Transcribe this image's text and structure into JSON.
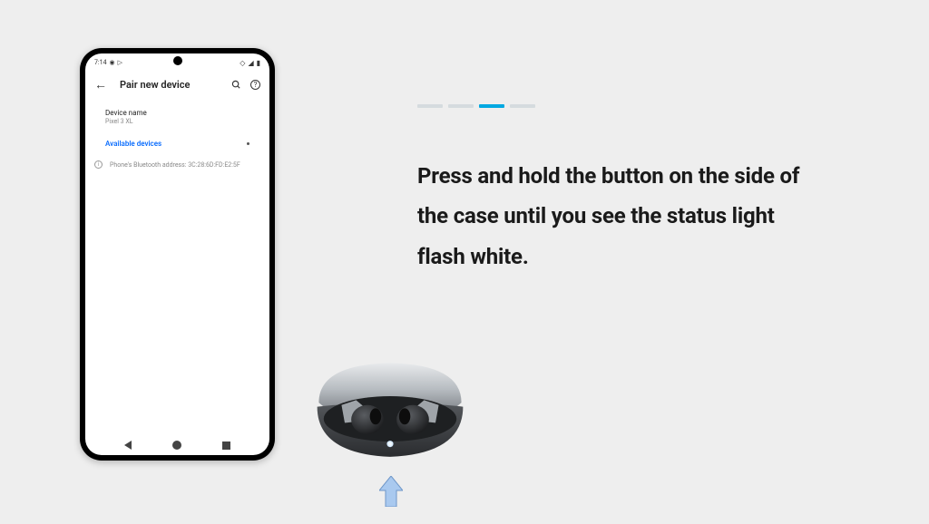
{
  "progress": {
    "total": 4,
    "active_index": 2
  },
  "instruction_text": "Press and hold the button on the side of the case until you see the status light flash white.",
  "phone": {
    "status_time": "7:14",
    "header_title": "Pair new device",
    "device_name_label": "Device name",
    "device_name_value": "Pixel 3 XL",
    "available_label": "Available devices",
    "bt_address_text": "Phone's Bluetooth address: 3C:28:6D:FD:E2:5F"
  }
}
